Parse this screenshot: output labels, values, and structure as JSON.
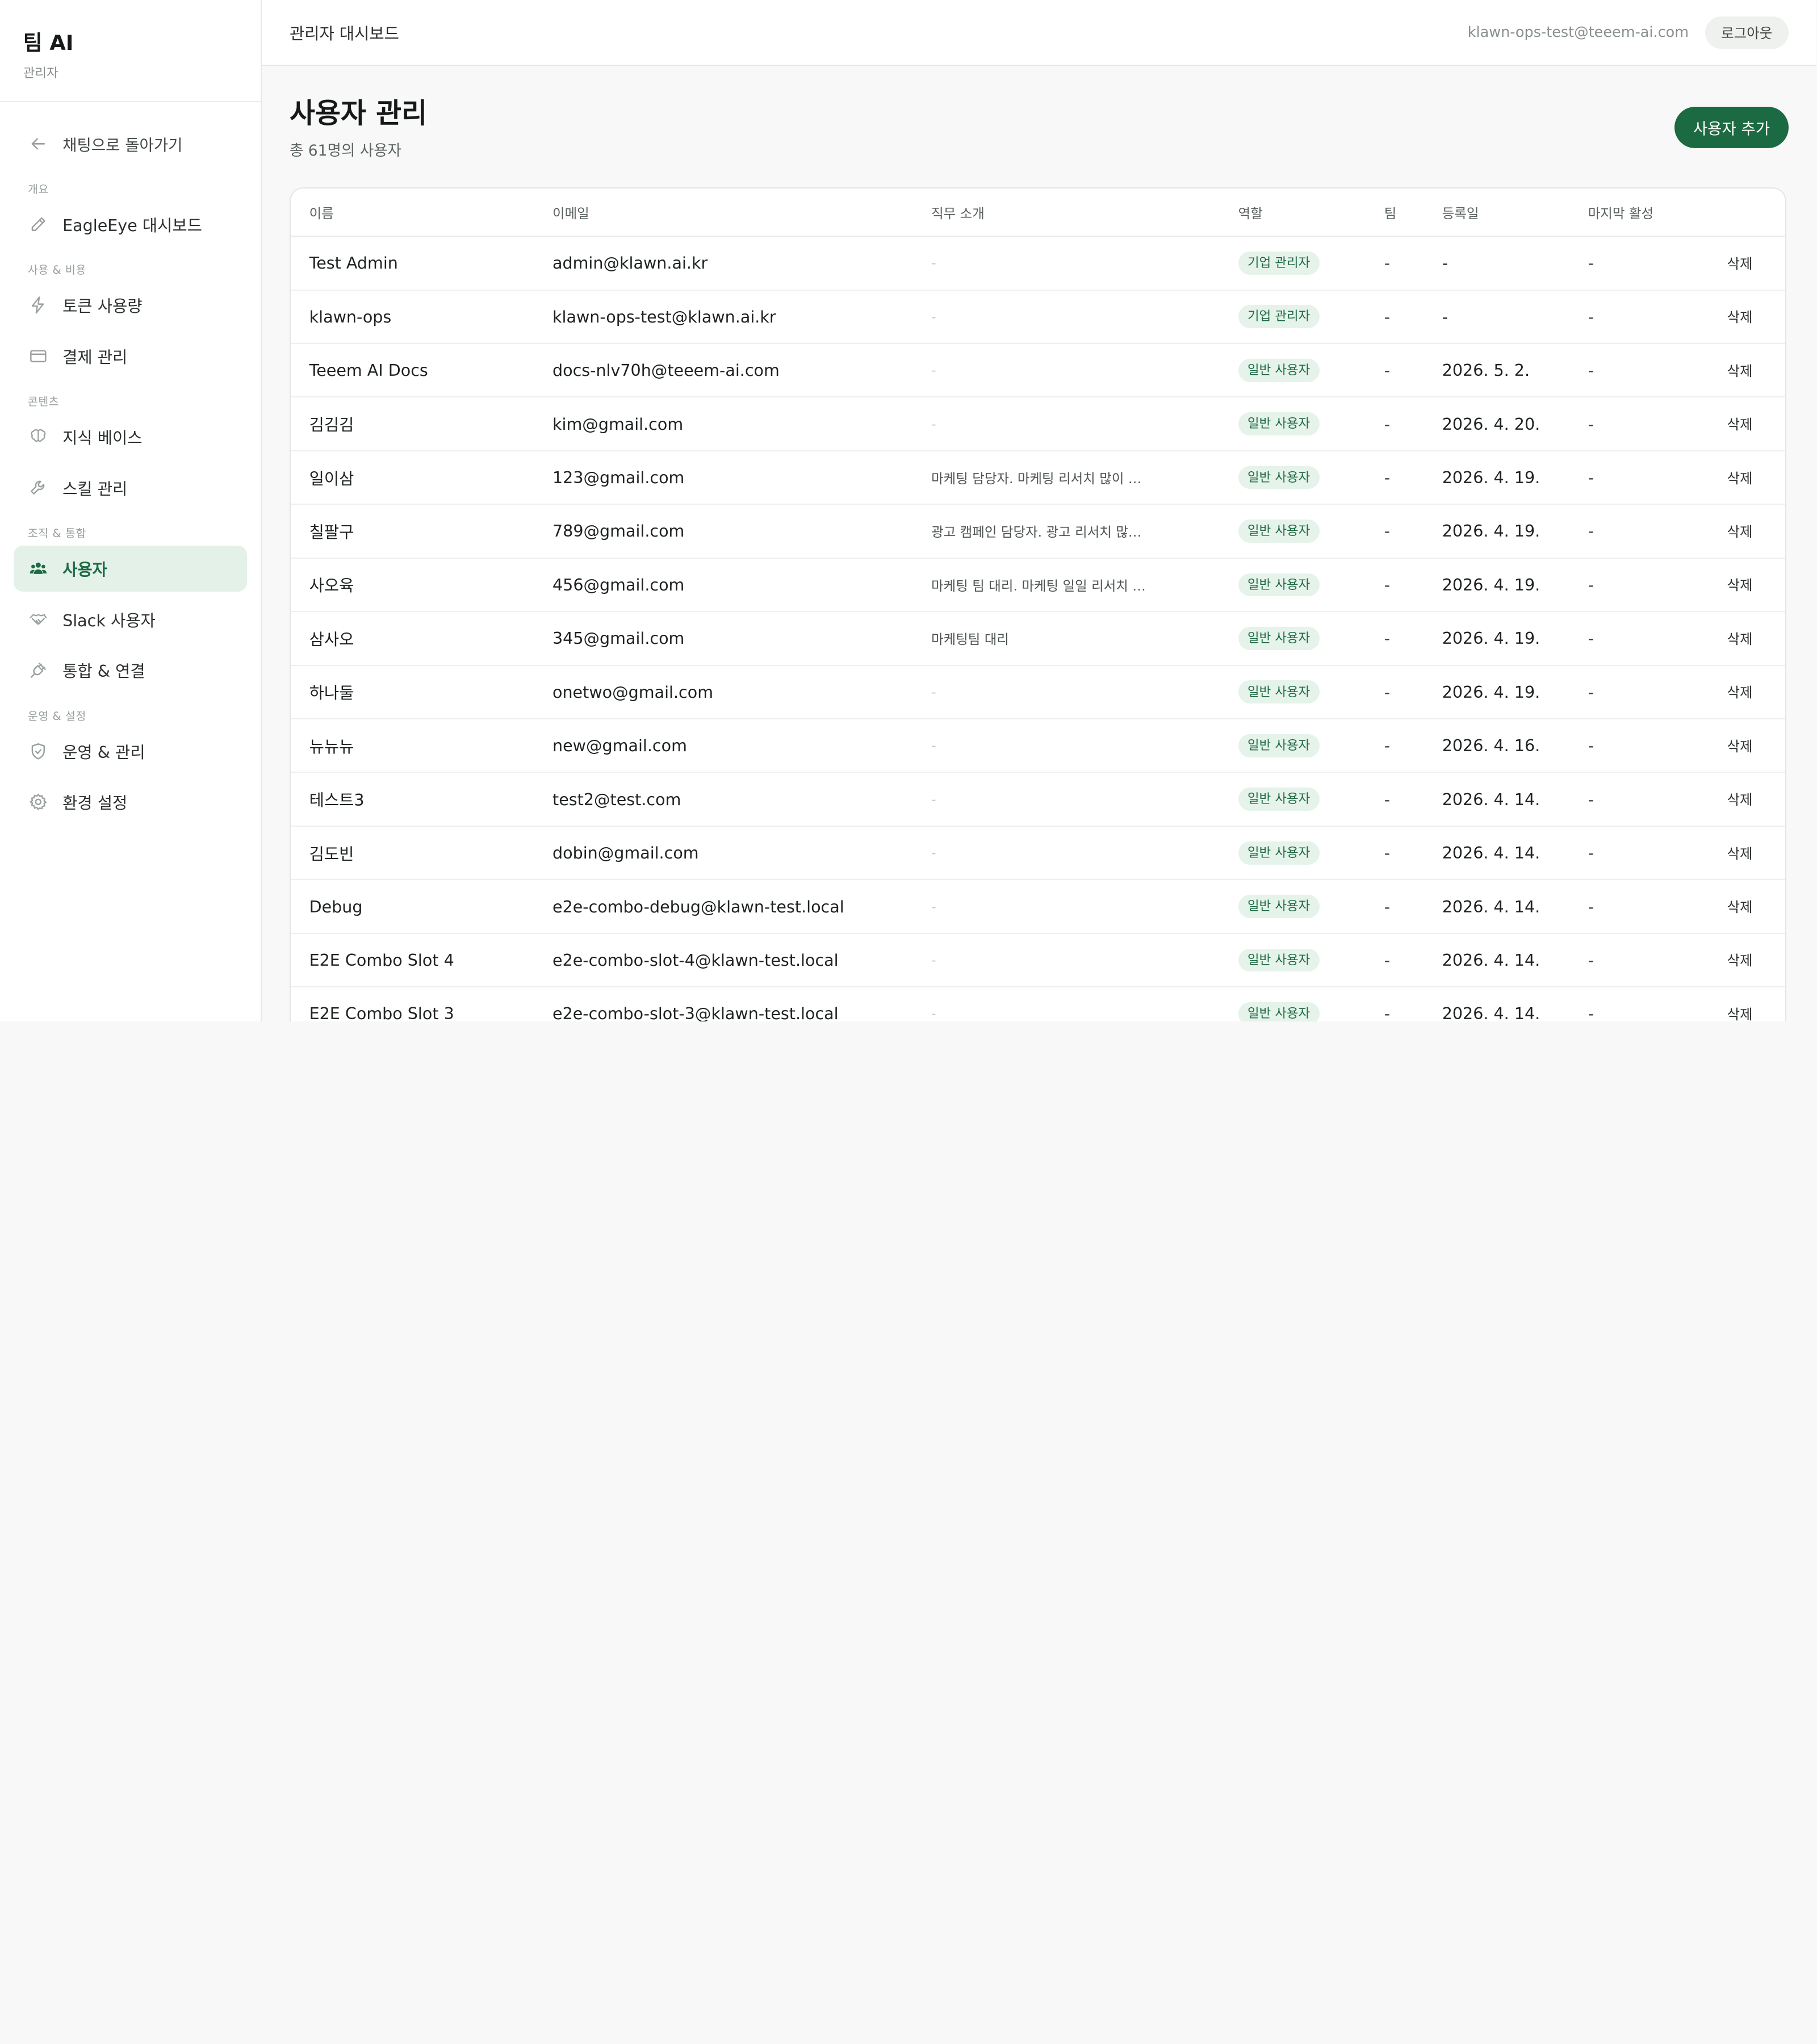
{
  "sidebar": {
    "brand_title": "팀 AI",
    "brand_sub": "관리자",
    "back_label": "채팅으로 돌아가기",
    "sections": {
      "overview": "개요",
      "usage": "사용 & 비용",
      "content": "콘텐츠",
      "org": "조직 & 통합",
      "ops": "운영 & 설정"
    },
    "items": {
      "eagleeye": "EagleEye 대시보드",
      "tokens": "토큰 사용량",
      "billing": "결제 관리",
      "knowledge": "지식 베이스",
      "skills": "스킬 관리",
      "users": "사용자",
      "slack": "Slack 사용자",
      "integrations": "통합 & 연결",
      "operations": "운영 & 관리",
      "settings": "환경 설정"
    },
    "active_item": "users"
  },
  "topbar": {
    "title": "관리자 대시보드",
    "user_email": "klawn-ops-test@teeem-ai.com",
    "logout_label": "로그아웃"
  },
  "page": {
    "title": "사용자 관리",
    "subtitle": "총 61명의 사용자",
    "add_button": "사용자 추가"
  },
  "table": {
    "columns": [
      "이름",
      "이메일",
      "직무 소개",
      "역할",
      "팀",
      "등록일",
      "마지막 활성",
      ""
    ],
    "delete_label": "삭제",
    "rows": [
      {
        "name": "Test Admin",
        "email": "admin@klawn.ai.kr",
        "desc": "-",
        "role": "기업 관리자",
        "team": "-",
        "registered": "-",
        "last_active": "-"
      },
      {
        "name": "klawn-ops",
        "email": "klawn-ops-test@klawn.ai.kr",
        "desc": "-",
        "role": "기업 관리자",
        "team": "-",
        "registered": "-",
        "last_active": "-"
      },
      {
        "name": "Teeem AI Docs",
        "email": "docs-nlv70h@teeem-ai.com",
        "desc": "-",
        "role": "일반 사용자",
        "team": "-",
        "registered": "2026. 5. 2.",
        "last_active": "-"
      },
      {
        "name": "김김김",
        "email": "kim@gmail.com",
        "desc": "-",
        "role": "일반 사용자",
        "team": "-",
        "registered": "2026. 4. 20.",
        "last_active": "-"
      },
      {
        "name": "일이삼",
        "email": "123@gmail.com",
        "desc": "마케팅 담당자. 마케팅 리서치 많이 …",
        "role": "일반 사용자",
        "team": "-",
        "registered": "2026. 4. 19.",
        "last_active": "-"
      },
      {
        "name": "칠팔구",
        "email": "789@gmail.com",
        "desc": "광고 캠페인 담당자. 광고 리서치 많…",
        "role": "일반 사용자",
        "team": "-",
        "registered": "2026. 4. 19.",
        "last_active": "-"
      },
      {
        "name": "사오육",
        "email": "456@gmail.com",
        "desc": "마케팅 팀 대리. 마케팅 일일 리서치 …",
        "role": "일반 사용자",
        "team": "-",
        "registered": "2026. 4. 19.",
        "last_active": "-"
      },
      {
        "name": "삼사오",
        "email": "345@gmail.com",
        "desc": "마케팅팀 대리",
        "role": "일반 사용자",
        "team": "-",
        "registered": "2026. 4. 19.",
        "last_active": "-"
      },
      {
        "name": "하나둘",
        "email": "onetwo@gmail.com",
        "desc": "-",
        "role": "일반 사용자",
        "team": "-",
        "registered": "2026. 4. 19.",
        "last_active": "-"
      },
      {
        "name": "뉴뉴뉴",
        "email": "new@gmail.com",
        "desc": "-",
        "role": "일반 사용자",
        "team": "-",
        "registered": "2026. 4. 16.",
        "last_active": "-"
      },
      {
        "name": "테스트3",
        "email": "test2@test.com",
        "desc": "-",
        "role": "일반 사용자",
        "team": "-",
        "registered": "2026. 4. 14.",
        "last_active": "-"
      },
      {
        "name": "김도빈",
        "email": "dobin@gmail.com",
        "desc": "-",
        "role": "일반 사용자",
        "team": "-",
        "registered": "2026. 4. 14.",
        "last_active": "-"
      },
      {
        "name": "Debug",
        "email": "e2e-combo-debug@klawn-test.local",
        "desc": "-",
        "role": "일반 사용자",
        "team": "-",
        "registered": "2026. 4. 14.",
        "last_active": "-"
      },
      {
        "name": "E2E Combo Slot 4",
        "email": "e2e-combo-slot-4@klawn-test.local",
        "desc": "-",
        "role": "일반 사용자",
        "team": "-",
        "registered": "2026. 4. 14.",
        "last_active": "-"
      },
      {
        "name": "E2E Combo Slot 3",
        "email": "e2e-combo-slot-3@klawn-test.local",
        "desc": "-",
        "role": "일반 사용자",
        "team": "-",
        "registered": "2026. 4. 14.",
        "last_active": "-"
      }
    ]
  },
  "colors": {
    "accent": "#1b6a41",
    "active_bg": "#e3f1e9",
    "badge_bg": "#e5f3ea",
    "badge_text": "#1e6a43"
  },
  "icons": {
    "back": "arrow-left-icon",
    "eagleeye": "pen-icon",
    "tokens": "lightning-icon",
    "billing": "credit-card-icon",
    "knowledge": "brain-icon",
    "skills": "wrench-icon",
    "users": "users-icon",
    "slack": "handshake-icon",
    "integrations": "plug-icon",
    "operations": "shield-icon",
    "settings": "gear-icon"
  }
}
